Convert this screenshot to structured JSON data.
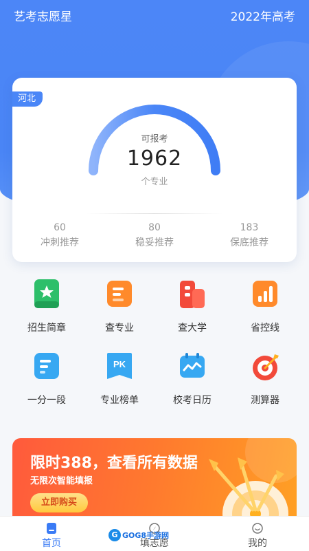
{
  "header": {
    "app_title": "艺考志愿星",
    "year_title": "2022年高考"
  },
  "summary_card": {
    "region": "河北",
    "gauge_label": "可报考",
    "gauge_value": "1962",
    "gauge_unit": "个专业",
    "recommendations": [
      {
        "count": "60",
        "label": "冲刺推荐"
      },
      {
        "count": "80",
        "label": "稳妥推荐"
      },
      {
        "count": "183",
        "label": "保底推荐"
      }
    ]
  },
  "features": [
    {
      "label": "招生简章",
      "icon": "book-star-icon",
      "color": "#2dbf6a"
    },
    {
      "label": "查专业",
      "icon": "document-lines-icon",
      "color": "#ff8a2b"
    },
    {
      "label": "查大学",
      "icon": "building-icon",
      "color": "#f24a3a"
    },
    {
      "label": "省控线",
      "icon": "bar-chart-icon",
      "color": "#ff8a2b"
    },
    {
      "label": "一分一段",
      "icon": "document-lines-icon",
      "color": "#37a8f2"
    },
    {
      "label": "专业榜单",
      "icon": "pk-icon",
      "color": "#37a8f2",
      "icon_text": "PK"
    },
    {
      "label": "校考日历",
      "icon": "calendar-wave-icon",
      "color": "#37a8f2"
    },
    {
      "label": "测算器",
      "icon": "target-icon",
      "color": "#f24a3a"
    }
  ],
  "banner": {
    "title": "限时388，查看所有数据",
    "subtitle": "无限次智能填报",
    "button": "立即购买"
  },
  "tabbar": {
    "items": [
      {
        "label": "首页",
        "icon": "home-icon",
        "active": true
      },
      {
        "label": "填志愿",
        "icon": "compass-icon",
        "active": false
      },
      {
        "label": "我的",
        "icon": "smile-icon",
        "active": false
      }
    ]
  },
  "watermark": {
    "badge": "G",
    "text": "GOG8手游网"
  },
  "colors": {
    "primary": "#4a86f7",
    "active_tab": "#3a7bf5",
    "banner_start": "#ff5a3c",
    "banner_end": "#ffa024"
  }
}
